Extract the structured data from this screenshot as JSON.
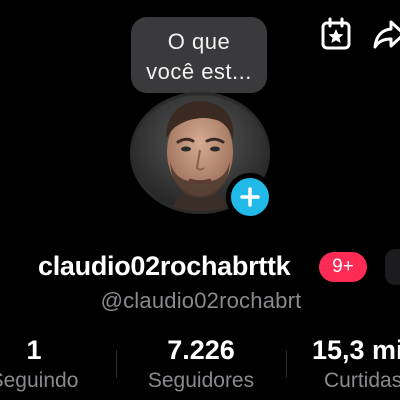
{
  "header": {
    "icons": [
      "calendar-star-icon",
      "share-icon"
    ]
  },
  "note": {
    "line1": "O que",
    "line2": "você est..."
  },
  "profile": {
    "avatar_icon": "profile-photo",
    "add_icon": "plus-icon",
    "username": "claudio02rochabrttk",
    "badge": "9+",
    "handle": "@claudio02rochabrt"
  },
  "stats": [
    {
      "value": "1",
      "label": "Seguindo"
    },
    {
      "value": "7.226",
      "label": "Seguidores"
    },
    {
      "value": "15,3 mi",
      "label": "Curtidas"
    }
  ],
  "colors": {
    "background": "#000000",
    "bubble": "#3a3a3c",
    "accent_blue": "#20b9e8",
    "badge_red": "#fe2c55",
    "secondary_text": "#8a8a8e"
  }
}
